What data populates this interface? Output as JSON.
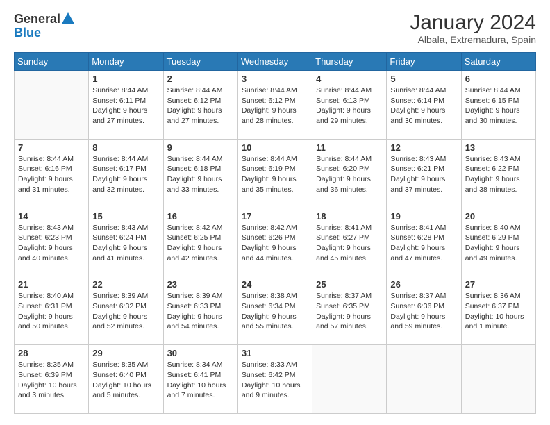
{
  "header": {
    "logo": {
      "general": "General",
      "blue": "Blue"
    },
    "title": "January 2024",
    "subtitle": "Albala, Extremadura, Spain"
  },
  "calendar": {
    "days_of_week": [
      "Sunday",
      "Monday",
      "Tuesday",
      "Wednesday",
      "Thursday",
      "Friday",
      "Saturday"
    ],
    "weeks": [
      [
        {
          "day": "",
          "sunrise": "",
          "sunset": "",
          "daylight": ""
        },
        {
          "day": "1",
          "sunrise": "Sunrise: 8:44 AM",
          "sunset": "Sunset: 6:11 PM",
          "daylight": "Daylight: 9 hours and 27 minutes."
        },
        {
          "day": "2",
          "sunrise": "Sunrise: 8:44 AM",
          "sunset": "Sunset: 6:12 PM",
          "daylight": "Daylight: 9 hours and 27 minutes."
        },
        {
          "day": "3",
          "sunrise": "Sunrise: 8:44 AM",
          "sunset": "Sunset: 6:12 PM",
          "daylight": "Daylight: 9 hours and 28 minutes."
        },
        {
          "day": "4",
          "sunrise": "Sunrise: 8:44 AM",
          "sunset": "Sunset: 6:13 PM",
          "daylight": "Daylight: 9 hours and 29 minutes."
        },
        {
          "day": "5",
          "sunrise": "Sunrise: 8:44 AM",
          "sunset": "Sunset: 6:14 PM",
          "daylight": "Daylight: 9 hours and 30 minutes."
        },
        {
          "day": "6",
          "sunrise": "Sunrise: 8:44 AM",
          "sunset": "Sunset: 6:15 PM",
          "daylight": "Daylight: 9 hours and 30 minutes."
        }
      ],
      [
        {
          "day": "7",
          "sunrise": "Sunrise: 8:44 AM",
          "sunset": "Sunset: 6:16 PM",
          "daylight": "Daylight: 9 hours and 31 minutes."
        },
        {
          "day": "8",
          "sunrise": "Sunrise: 8:44 AM",
          "sunset": "Sunset: 6:17 PM",
          "daylight": "Daylight: 9 hours and 32 minutes."
        },
        {
          "day": "9",
          "sunrise": "Sunrise: 8:44 AM",
          "sunset": "Sunset: 6:18 PM",
          "daylight": "Daylight: 9 hours and 33 minutes."
        },
        {
          "day": "10",
          "sunrise": "Sunrise: 8:44 AM",
          "sunset": "Sunset: 6:19 PM",
          "daylight": "Daylight: 9 hours and 35 minutes."
        },
        {
          "day": "11",
          "sunrise": "Sunrise: 8:44 AM",
          "sunset": "Sunset: 6:20 PM",
          "daylight": "Daylight: 9 hours and 36 minutes."
        },
        {
          "day": "12",
          "sunrise": "Sunrise: 8:43 AM",
          "sunset": "Sunset: 6:21 PM",
          "daylight": "Daylight: 9 hours and 37 minutes."
        },
        {
          "day": "13",
          "sunrise": "Sunrise: 8:43 AM",
          "sunset": "Sunset: 6:22 PM",
          "daylight": "Daylight: 9 hours and 38 minutes."
        }
      ],
      [
        {
          "day": "14",
          "sunrise": "Sunrise: 8:43 AM",
          "sunset": "Sunset: 6:23 PM",
          "daylight": "Daylight: 9 hours and 40 minutes."
        },
        {
          "day": "15",
          "sunrise": "Sunrise: 8:43 AM",
          "sunset": "Sunset: 6:24 PM",
          "daylight": "Daylight: 9 hours and 41 minutes."
        },
        {
          "day": "16",
          "sunrise": "Sunrise: 8:42 AM",
          "sunset": "Sunset: 6:25 PM",
          "daylight": "Daylight: 9 hours and 42 minutes."
        },
        {
          "day": "17",
          "sunrise": "Sunrise: 8:42 AM",
          "sunset": "Sunset: 6:26 PM",
          "daylight": "Daylight: 9 hours and 44 minutes."
        },
        {
          "day": "18",
          "sunrise": "Sunrise: 8:41 AM",
          "sunset": "Sunset: 6:27 PM",
          "daylight": "Daylight: 9 hours and 45 minutes."
        },
        {
          "day": "19",
          "sunrise": "Sunrise: 8:41 AM",
          "sunset": "Sunset: 6:28 PM",
          "daylight": "Daylight: 9 hours and 47 minutes."
        },
        {
          "day": "20",
          "sunrise": "Sunrise: 8:40 AM",
          "sunset": "Sunset: 6:29 PM",
          "daylight": "Daylight: 9 hours and 49 minutes."
        }
      ],
      [
        {
          "day": "21",
          "sunrise": "Sunrise: 8:40 AM",
          "sunset": "Sunset: 6:31 PM",
          "daylight": "Daylight: 9 hours and 50 minutes."
        },
        {
          "day": "22",
          "sunrise": "Sunrise: 8:39 AM",
          "sunset": "Sunset: 6:32 PM",
          "daylight": "Daylight: 9 hours and 52 minutes."
        },
        {
          "day": "23",
          "sunrise": "Sunrise: 8:39 AM",
          "sunset": "Sunset: 6:33 PM",
          "daylight": "Daylight: 9 hours and 54 minutes."
        },
        {
          "day": "24",
          "sunrise": "Sunrise: 8:38 AM",
          "sunset": "Sunset: 6:34 PM",
          "daylight": "Daylight: 9 hours and 55 minutes."
        },
        {
          "day": "25",
          "sunrise": "Sunrise: 8:37 AM",
          "sunset": "Sunset: 6:35 PM",
          "daylight": "Daylight: 9 hours and 57 minutes."
        },
        {
          "day": "26",
          "sunrise": "Sunrise: 8:37 AM",
          "sunset": "Sunset: 6:36 PM",
          "daylight": "Daylight: 9 hours and 59 minutes."
        },
        {
          "day": "27",
          "sunrise": "Sunrise: 8:36 AM",
          "sunset": "Sunset: 6:37 PM",
          "daylight": "Daylight: 10 hours and 1 minute."
        }
      ],
      [
        {
          "day": "28",
          "sunrise": "Sunrise: 8:35 AM",
          "sunset": "Sunset: 6:39 PM",
          "daylight": "Daylight: 10 hours and 3 minutes."
        },
        {
          "day": "29",
          "sunrise": "Sunrise: 8:35 AM",
          "sunset": "Sunset: 6:40 PM",
          "daylight": "Daylight: 10 hours and 5 minutes."
        },
        {
          "day": "30",
          "sunrise": "Sunrise: 8:34 AM",
          "sunset": "Sunset: 6:41 PM",
          "daylight": "Daylight: 10 hours and 7 minutes."
        },
        {
          "day": "31",
          "sunrise": "Sunrise: 8:33 AM",
          "sunset": "Sunset: 6:42 PM",
          "daylight": "Daylight: 10 hours and 9 minutes."
        },
        {
          "day": "",
          "sunrise": "",
          "sunset": "",
          "daylight": ""
        },
        {
          "day": "",
          "sunrise": "",
          "sunset": "",
          "daylight": ""
        },
        {
          "day": "",
          "sunrise": "",
          "sunset": "",
          "daylight": ""
        }
      ]
    ]
  }
}
